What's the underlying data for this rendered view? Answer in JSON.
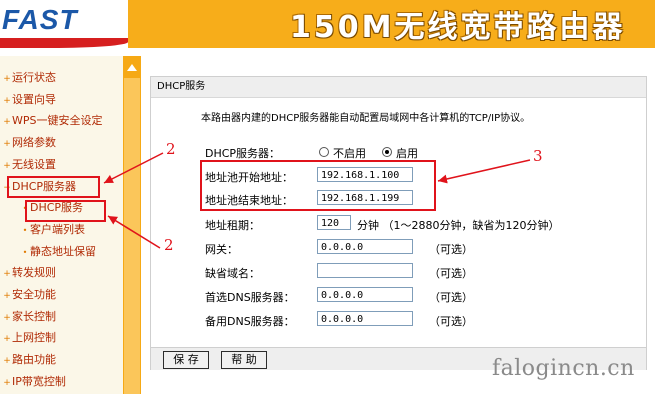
{
  "header": {
    "logo": "FAST",
    "product_title": "150M无线宽带路由器"
  },
  "sidebar": {
    "items": [
      {
        "label": "运行状态",
        "level": 1
      },
      {
        "label": "设置向导",
        "level": 1
      },
      {
        "label": "WPS一键安全设定",
        "level": 1
      },
      {
        "label": "网络参数",
        "level": 1
      },
      {
        "label": "无线设置",
        "level": 1
      },
      {
        "label": "DHCP服务器",
        "level": 1,
        "expanded": true
      },
      {
        "label": "DHCP服务",
        "level": 2,
        "selected": true
      },
      {
        "label": "客户端列表",
        "level": 2
      },
      {
        "label": "静态地址保留",
        "level": 2
      },
      {
        "label": "转发规则",
        "level": 1
      },
      {
        "label": "安全功能",
        "level": 1
      },
      {
        "label": "家长控制",
        "level": 1
      },
      {
        "label": "上网控制",
        "level": 1
      },
      {
        "label": "路由功能",
        "level": 1
      },
      {
        "label": "IP带宽控制",
        "level": 1
      }
    ]
  },
  "panel": {
    "title": "DHCP服务",
    "description": "本路由器内建的DHCP服务器能自动配置局域网中各计算机的TCP/IP协议。",
    "dhcp_server": {
      "label": "DHCP服务器：",
      "options": [
        "不启用",
        "启用"
      ],
      "selected": "启用"
    },
    "start_address": {
      "label": "地址池开始地址：",
      "value": "192.168.1.100"
    },
    "end_address": {
      "label": "地址池结束地址：",
      "value": "192.168.1.199"
    },
    "lease": {
      "label": "地址租期：",
      "value": "120",
      "unit_hint": "分钟 （1～2880分钟，缺省为120分钟）"
    },
    "gateway": {
      "label": "网关：",
      "value": "0.0.0.0",
      "hint": "（可选）"
    },
    "domain": {
      "label": "缺省域名：",
      "value": "",
      "hint": "（可选）"
    },
    "primary_dns": {
      "label": "首选DNS服务器：",
      "value": "0.0.0.0",
      "hint": "（可选）"
    },
    "secondary_dns": {
      "label": "备用DNS服务器：",
      "value": "0.0.0.0",
      "hint": "（可选）"
    },
    "buttons": {
      "save": "保 存",
      "help": "帮 助"
    }
  },
  "annotations": {
    "marker_2a": "2",
    "marker_2b": "2",
    "marker_3": "3",
    "color": "#e0131b"
  },
  "watermark": "falogincn.cn",
  "colors": {
    "header": "#f7ad1a",
    "logo_blue": "#1b58a8",
    "nav_text": "#b02a05"
  }
}
